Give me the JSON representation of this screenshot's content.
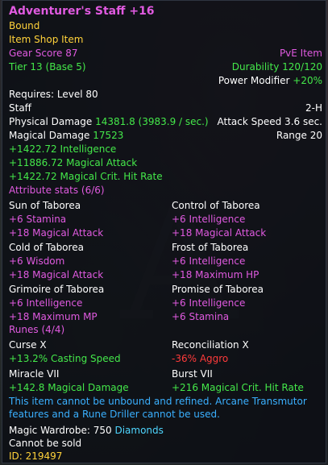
{
  "colors": {
    "title": "#e05ae0",
    "white": "#ffffff",
    "yellow": "#ffd23a",
    "magenta": "#e05ae0",
    "green": "#44e84a",
    "red": "#ff3b3b",
    "blue": "#3ab0ff",
    "cyan": "#4fd6ff"
  },
  "item": {
    "name": "Adventurer's Staff +16",
    "bound": "Bound",
    "shop": "Item Shop Item",
    "gear_score": "Gear Score 87",
    "pve": "PvE Item",
    "tier": "Tier 13 (Base 5)",
    "durability": "Durability 120/120",
    "power_modifier_label": "Power Modifier ",
    "power_modifier_value": "+20%",
    "requires": "Requires: Level 80",
    "type": "Staff",
    "hand": "2-H",
    "phys_label": "Physical Damage ",
    "phys_value": "14381.8 (3983.9 / sec.)",
    "attack_speed": "Attack Speed 3.6 sec.",
    "mag_label": "Magical Damage ",
    "mag_value": "17523",
    "range": "Range 20",
    "bonuses": [
      "+1422.72 Intelligence",
      "+11886.72 Magical Attack",
      "+1422.72 Magical Crit. Hit Rate"
    ],
    "attribute_header": "Attribute stats (6/6)",
    "attributes": [
      {
        "name": "Sun of Taborea",
        "lines": [
          "+6 Stamina",
          "+18 Magical Attack"
        ]
      },
      {
        "name": "Control of Taborea",
        "lines": [
          "+6 Intelligence",
          "+18 Magical Attack"
        ]
      },
      {
        "name": "Cold of Taborea",
        "lines": [
          "+6 Wisdom",
          "+18 Magical Attack"
        ]
      },
      {
        "name": "Frost of Taborea",
        "lines": [
          "+6 Intelligence",
          "+18 Maximum HP"
        ]
      },
      {
        "name": "Grimoire of Taborea",
        "lines": [
          "+6 Intelligence",
          "+18 Maximum MP"
        ]
      },
      {
        "name": "Promise of Taborea",
        "lines": [
          "+6 Intelligence",
          "+6 Stamina"
        ]
      }
    ],
    "runes_header": "Runes (4/4)",
    "runes": [
      {
        "name": "Curse X",
        "effect": "+13.2% Casting Speed",
        "color": "green"
      },
      {
        "name": "Reconciliation X",
        "effect": "-36% Aggro",
        "color": "red"
      },
      {
        "name": "Miracle VII",
        "effect": "+142.8 Magical Damage",
        "color": "green"
      },
      {
        "name": "Burst VII",
        "effect": "+216 Magical Crit. Hit Rate",
        "color": "green"
      }
    ],
    "note_line1": "This item cannot be unbound and refined. Arcane Transmutor",
    "note_line2": "features and a Rune Driller cannot be used.",
    "wardrobe_label": "Magic Wardrobe: 750 ",
    "wardrobe_value": "Diamonds",
    "sold": "Cannot be sold",
    "id": "ID: 219497"
  }
}
